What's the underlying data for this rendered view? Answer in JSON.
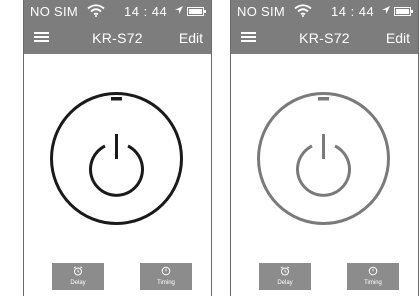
{
  "status_bar": {
    "carrier": "NO SIM",
    "time": "14 : 44"
  },
  "header": {
    "title": "KR-S72",
    "edit_label": "Edit"
  },
  "buttons": {
    "delay_label": "Delay",
    "timing_label": "Timing"
  },
  "screens": [
    {
      "state": "on",
      "power_ring_color": "#1a1a1a"
    },
    {
      "state": "off",
      "power_ring_color": "#7a7a7a"
    }
  ],
  "colors": {
    "bar_background": "#7d7d7d",
    "button_background": "#8c8c8c"
  }
}
